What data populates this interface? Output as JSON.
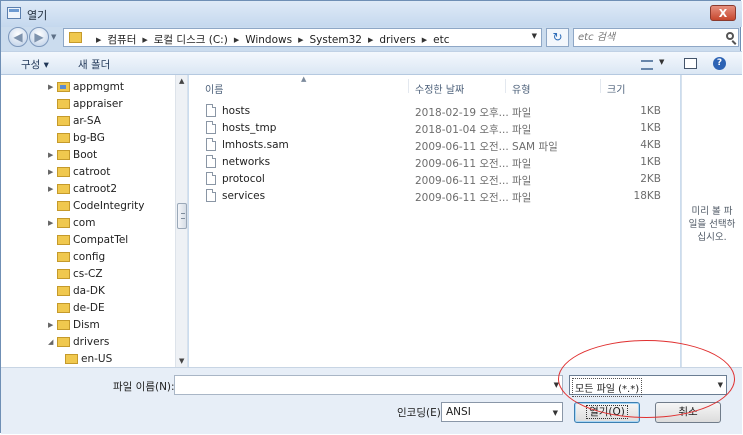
{
  "window": {
    "title": "열기",
    "close_label": "X"
  },
  "address_bar": {
    "breadcrumbs": [
      "컴퓨터",
      "로컬 디스크 (C:)",
      "Windows",
      "System32",
      "drivers",
      "etc"
    ],
    "refresh_label": "↻"
  },
  "search": {
    "placeholder": "etc 검색"
  },
  "toolbar": {
    "organize_label": "구성 ▾",
    "new_folder_label": "새 폴더"
  },
  "tree": {
    "items": [
      {
        "label": "appmgmt",
        "expandable": true,
        "special": true
      },
      {
        "label": "appraiser",
        "expandable": false
      },
      {
        "label": "ar-SA",
        "expandable": false
      },
      {
        "label": "bg-BG",
        "expandable": false
      },
      {
        "label": "Boot",
        "expandable": true
      },
      {
        "label": "catroot",
        "expandable": true
      },
      {
        "label": "catroot2",
        "expandable": true
      },
      {
        "label": "CodeIntegrity",
        "expandable": false
      },
      {
        "label": "com",
        "expandable": true
      },
      {
        "label": "CompatTel",
        "expandable": false
      },
      {
        "label": "config",
        "expandable": false
      },
      {
        "label": "cs-CZ",
        "expandable": false
      },
      {
        "label": "da-DK",
        "expandable": false
      },
      {
        "label": "de-DE",
        "expandable": false
      },
      {
        "label": "Dism",
        "expandable": true
      },
      {
        "label": "drivers",
        "expandable": true,
        "expanded": true
      },
      {
        "label": "en-US",
        "expandable": false,
        "child": true
      }
    ]
  },
  "file_list": {
    "columns": [
      "이름",
      "수정한 날짜",
      "유형",
      "크기"
    ],
    "rows": [
      {
        "name": "hosts",
        "date": "2018-02-19 오후...",
        "type": "파일",
        "size": "1KB"
      },
      {
        "name": "hosts_tmp",
        "date": "2018-01-04 오후...",
        "type": "파일",
        "size": "1KB"
      },
      {
        "name": "lmhosts.sam",
        "date": "2009-06-11 오전...",
        "type": "SAM 파일",
        "size": "4KB"
      },
      {
        "name": "networks",
        "date": "2009-06-11 오전...",
        "type": "파일",
        "size": "1KB"
      },
      {
        "name": "protocol",
        "date": "2009-06-11 오전...",
        "type": "파일",
        "size": "2KB"
      },
      {
        "name": "services",
        "date": "2009-06-11 오전...",
        "type": "파일",
        "size": "18KB"
      }
    ]
  },
  "preview": {
    "text_line1": "미리 볼 파",
    "text_line2": "일을 선택하",
    "text_line3": "십시오."
  },
  "bottom": {
    "filename_label": "파일 이름(N):",
    "filename_value": "",
    "filter_value": "모든 파일 (*.*)",
    "encoding_label": "인코딩(E):",
    "encoding_value": "ANSI",
    "open_label": "열기(O)",
    "cancel_label": "취소"
  },
  "annotation": {
    "color": "#e03030",
    "shape": "ellipse"
  }
}
